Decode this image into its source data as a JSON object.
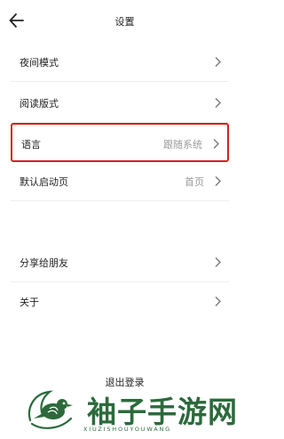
{
  "header": {
    "title": "设置",
    "back_icon": "arrow-left-icon"
  },
  "settings": {
    "night_mode": {
      "label": "夜间模式"
    },
    "reading_layout": {
      "label": "阅读版式"
    },
    "language": {
      "label": "语言",
      "value": "跟随系统",
      "highlight_color": "#d61f1f"
    },
    "default_start_page": {
      "label": "默认启动页",
      "value": "首页"
    },
    "share": {
      "label": "分享给朋友"
    },
    "about": {
      "label": "关于"
    }
  },
  "logout": {
    "label": "退出登录"
  },
  "watermark": {
    "title": "袖子手游网",
    "subtitle": "XIUZISHOUYOUWANG",
    "color": "#2c6a3c"
  }
}
